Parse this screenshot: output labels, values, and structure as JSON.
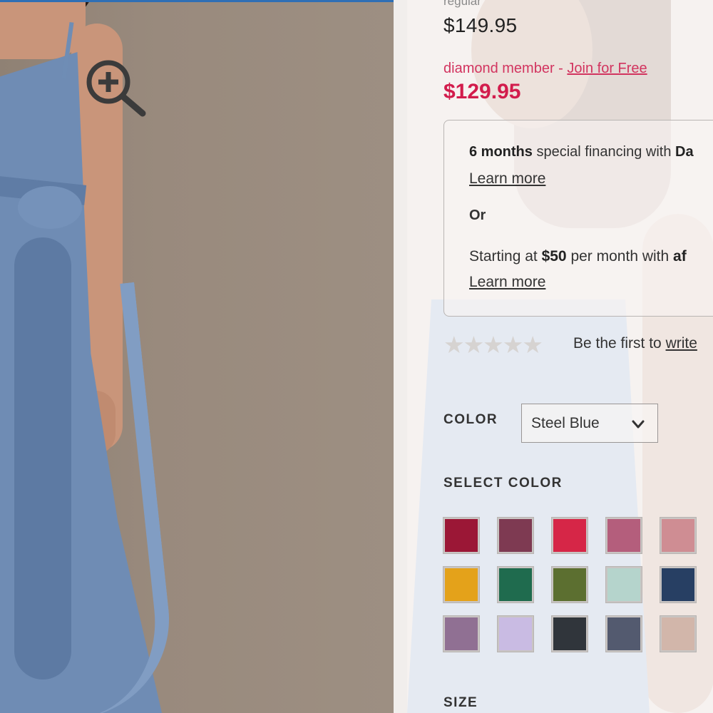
{
  "pricing": {
    "regular_label": "regular",
    "regular_price": "$149.95",
    "member_label": "diamond member - ",
    "member_link": "Join for Free",
    "member_price": "$129.95"
  },
  "financing": {
    "line1_bold": "6 months",
    "line1_text": " special financing with ",
    "line1_brand": "Da",
    "learn_more_1": "Learn more",
    "or_text": "Or",
    "line2_prefix": "Starting at ",
    "line2_bold": "$50",
    "line2_text": " per month with ",
    "line2_brand": "af",
    "learn_more_2": "Learn more"
  },
  "reviews": {
    "stars": "★★★★★",
    "prefix": "Be the first to ",
    "link": "write"
  },
  "color": {
    "label": "COLOR",
    "selected": "Steel Blue",
    "select_label": "SELECT COLOR",
    "swatches": [
      {
        "name": "swatch-1",
        "hex": "#9b1736"
      },
      {
        "name": "swatch-2",
        "hex": "#7e3a52"
      },
      {
        "name": "swatch-3",
        "hex": "#d62647"
      },
      {
        "name": "swatch-4",
        "hex": "#b45e7c"
      },
      {
        "name": "swatch-5",
        "hex": "#cf8d93"
      },
      {
        "name": "swatch-6",
        "hex": "#e4a21a"
      },
      {
        "name": "swatch-7",
        "hex": "#1f6b4e"
      },
      {
        "name": "swatch-8",
        "hex": "#5c6f30"
      },
      {
        "name": "swatch-9",
        "hex": "#b5d4cc"
      },
      {
        "name": "swatch-10",
        "hex": "#273f63"
      },
      {
        "name": "swatch-11",
        "hex": "#907093"
      },
      {
        "name": "swatch-12",
        "hex": "#c9bbe3"
      },
      {
        "name": "swatch-13",
        "hex": "#30353b"
      },
      {
        "name": "swatch-14",
        "hex": "#535a6f"
      },
      {
        "name": "swatch-15",
        "hex": "#d2b6aa"
      }
    ]
  },
  "size": {
    "label": "SIZE"
  },
  "icons": {
    "zoom": "zoom-in-icon",
    "dropdown": "chevron-down-icon"
  }
}
